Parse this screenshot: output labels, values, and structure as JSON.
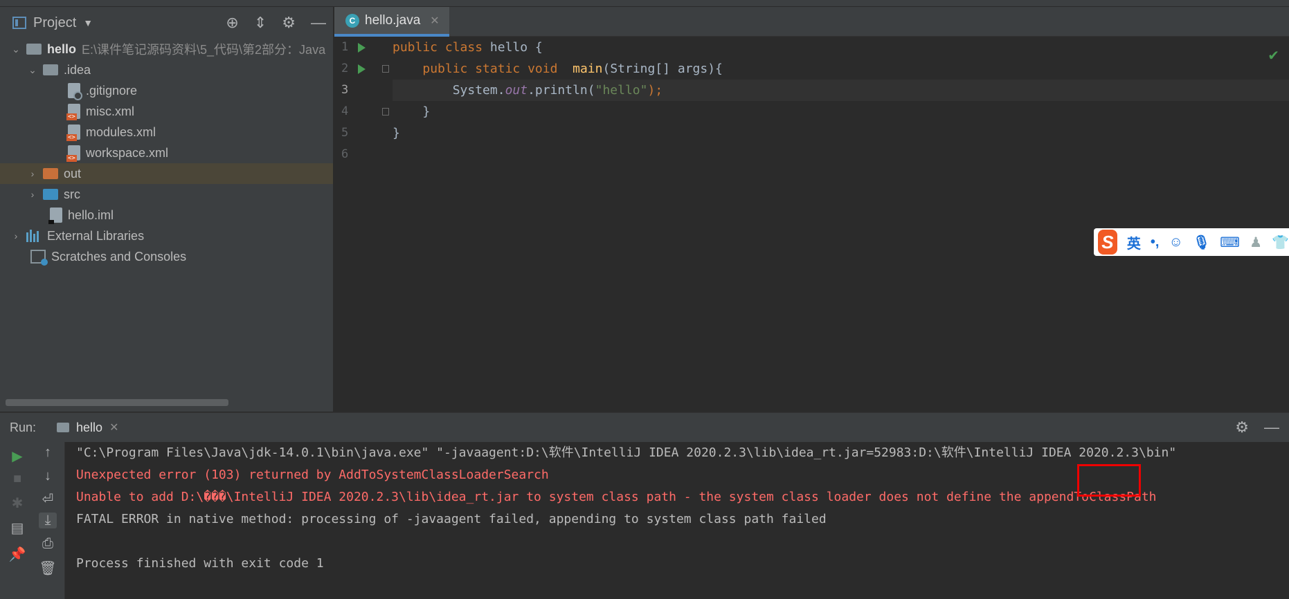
{
  "project_panel": {
    "title": "Project",
    "tree": [
      {
        "label": "hello",
        "path": "E:\\课件笔记源码资料\\5_代码\\第2部分：Java",
        "kind": "module"
      },
      {
        "label": ".idea",
        "kind": "folder"
      },
      {
        "label": ".gitignore",
        "kind": "file"
      },
      {
        "label": "misc.xml",
        "kind": "xml"
      },
      {
        "label": "modules.xml",
        "kind": "xml"
      },
      {
        "label": "workspace.xml",
        "kind": "xml"
      },
      {
        "label": "out",
        "kind": "folder"
      },
      {
        "label": "src",
        "kind": "folder"
      },
      {
        "label": "hello.iml",
        "kind": "file"
      },
      {
        "label": "External Libraries",
        "kind": "library"
      },
      {
        "label": "Scratches and Consoles",
        "kind": "scratch"
      }
    ]
  },
  "editor": {
    "tab_label": "hello.java",
    "line_numbers": [
      "1",
      "2",
      "3",
      "4",
      "5",
      "6"
    ],
    "code": {
      "l1_kw1": "public",
      "l1_kw2": "class",
      "l1_rest": " hello {",
      "l2_kw": "public static void",
      "l2_fn": "main",
      "l2_rest": "(String[] args){",
      "l3_a": "System.",
      "l3_out": "out",
      "l3_b": ".println(",
      "l3_str": "\"hello\"",
      "l3_c": ");",
      "l4": "}",
      "l5": "}"
    }
  },
  "ime_toolbar": {
    "logo": "S",
    "mode": "英",
    "punct": "•,",
    "icons": [
      "emoji-icon",
      "microphone-icon",
      "keyboard-icon",
      "user-icon",
      "skin-icon"
    ]
  },
  "run_panel": {
    "label": "Run:",
    "tab_label": "hello",
    "console": [
      {
        "text": "\"C:\\Program Files\\Java\\jdk-14.0.1\\bin\\java.exe\" \"-javaagent:D:\\软件\\IntelliJ IDEA 2020.2.3\\lib\\idea_rt.jar=52983:D:\\软件\\IntelliJ IDEA 2020.2.3\\bin\"",
        "type": "normal"
      },
      {
        "text": "Unexpected error (103) returned by AddToSystemClassLoaderSearch",
        "type": "error"
      },
      {
        "text": "Unable to add D:\\���\\IntelliJ IDEA 2020.2.3\\lib\\idea_rt.jar to system class path - the system class loader does not define the appendToClassPath",
        "type": "error"
      },
      {
        "text": "FATAL ERROR in native method: processing of -javaagent failed, appending to system class path failed",
        "type": "normal"
      },
      {
        "text": "",
        "type": "normal"
      },
      {
        "text": "Process finished with exit code 1",
        "type": "normal"
      }
    ]
  }
}
